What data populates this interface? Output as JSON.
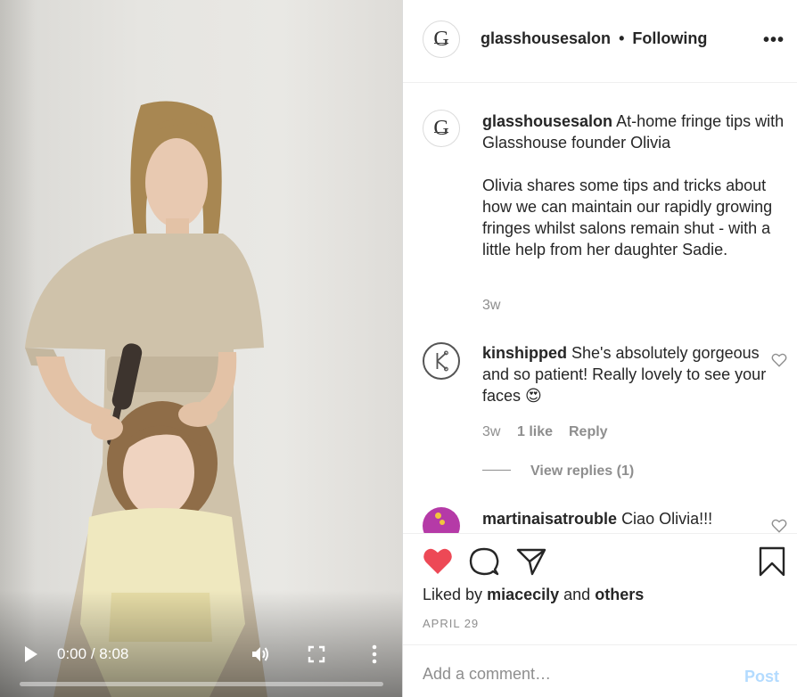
{
  "video": {
    "current_time": "0:00",
    "separator": "/",
    "duration": "8:08",
    "progress": 0,
    "icons": [
      "play-icon",
      "volume-icon",
      "fullscreen-icon",
      "more-vertical-icon"
    ]
  },
  "header": {
    "avatar_letter": "G",
    "username": "glasshousesalon",
    "separator": "•",
    "follow_status": "Following",
    "more": "•••"
  },
  "caption": {
    "avatar_letter": "G",
    "username": "glasshousesalon",
    "title": "At-home fringe tips with Glasshouse founder Olivia",
    "body": "Olivia shares some tips and tricks about how we can maintain our rapidly growing fringes whilst salons remain shut - with a little help from her daughter Sadie.",
    "age": "3w"
  },
  "comments": [
    {
      "username": "kinshipped",
      "text": "She's absolutely gorgeous and so patient! Really lovely to see your faces 😍",
      "age": "3w",
      "likes": "1 like",
      "reply": "Reply",
      "view_replies": "View replies (1)"
    },
    {
      "username": "martinaisatrouble",
      "text": "Ciao Olivia!!!"
    }
  ],
  "actions": {
    "liked_prefix": "Liked by",
    "liked_user": "miacecily",
    "liked_and": "and",
    "liked_others": "others",
    "date": "APRIL 29",
    "liked": true,
    "like_color": "#ed4956"
  },
  "add_comment": {
    "placeholder": "Add a comment…",
    "post_label": "Post",
    "post_color": "#b3dbff"
  }
}
